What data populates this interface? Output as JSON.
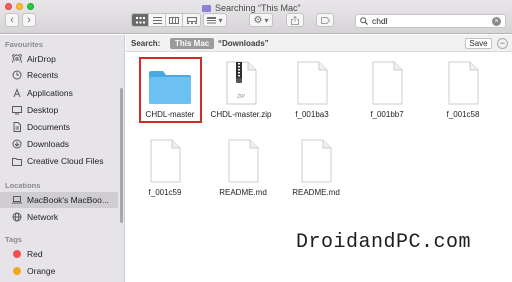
{
  "window": {
    "title": "Searching “This Mac”"
  },
  "search": {
    "value": "chdl",
    "placeholder": "Search"
  },
  "scope": {
    "label": "Search:",
    "active": "This Mac",
    "other": "“Downloads”",
    "save_label": "Save",
    "remove_label": "−"
  },
  "sidebar": {
    "favourites_heading": "Favourites",
    "favourites": [
      {
        "label": "AirDrop",
        "icon": "airdrop-icon"
      },
      {
        "label": "Recents",
        "icon": "recents-icon"
      },
      {
        "label": "Applications",
        "icon": "applications-icon"
      },
      {
        "label": "Desktop",
        "icon": "desktop-icon"
      },
      {
        "label": "Documents",
        "icon": "documents-icon"
      },
      {
        "label": "Downloads",
        "icon": "downloads-icon"
      },
      {
        "label": "Creative Cloud Files",
        "icon": "folder-icon"
      }
    ],
    "locations_heading": "Locations",
    "locations": [
      {
        "label": "MacBook's MacBoo...",
        "icon": "laptop-icon"
      },
      {
        "label": "Network",
        "icon": "network-icon"
      }
    ],
    "tags_heading": "Tags",
    "tags": [
      {
        "label": "Red",
        "color": "#f0504f"
      },
      {
        "label": "Orange",
        "color": "#f5a623"
      }
    ]
  },
  "files": [
    {
      "name": "CHDL-master",
      "type": "folder"
    },
    {
      "name": "CHDL-master.zip",
      "type": "zip",
      "badge": "ZIP"
    },
    {
      "name": "f_001ba3",
      "type": "document"
    },
    {
      "name": "f_001bb7",
      "type": "document"
    },
    {
      "name": "f_001c58",
      "type": "document"
    },
    {
      "name": "f_001c59",
      "type": "document"
    },
    {
      "name": "README.md",
      "type": "document"
    },
    {
      "name": "README.md",
      "type": "document"
    }
  ],
  "watermark": "DroidandPC.com",
  "colors": {
    "accent_folder": "#5eb8ec",
    "highlight": "#d32a2a",
    "sidebar_bg": "#e6e4e8"
  }
}
